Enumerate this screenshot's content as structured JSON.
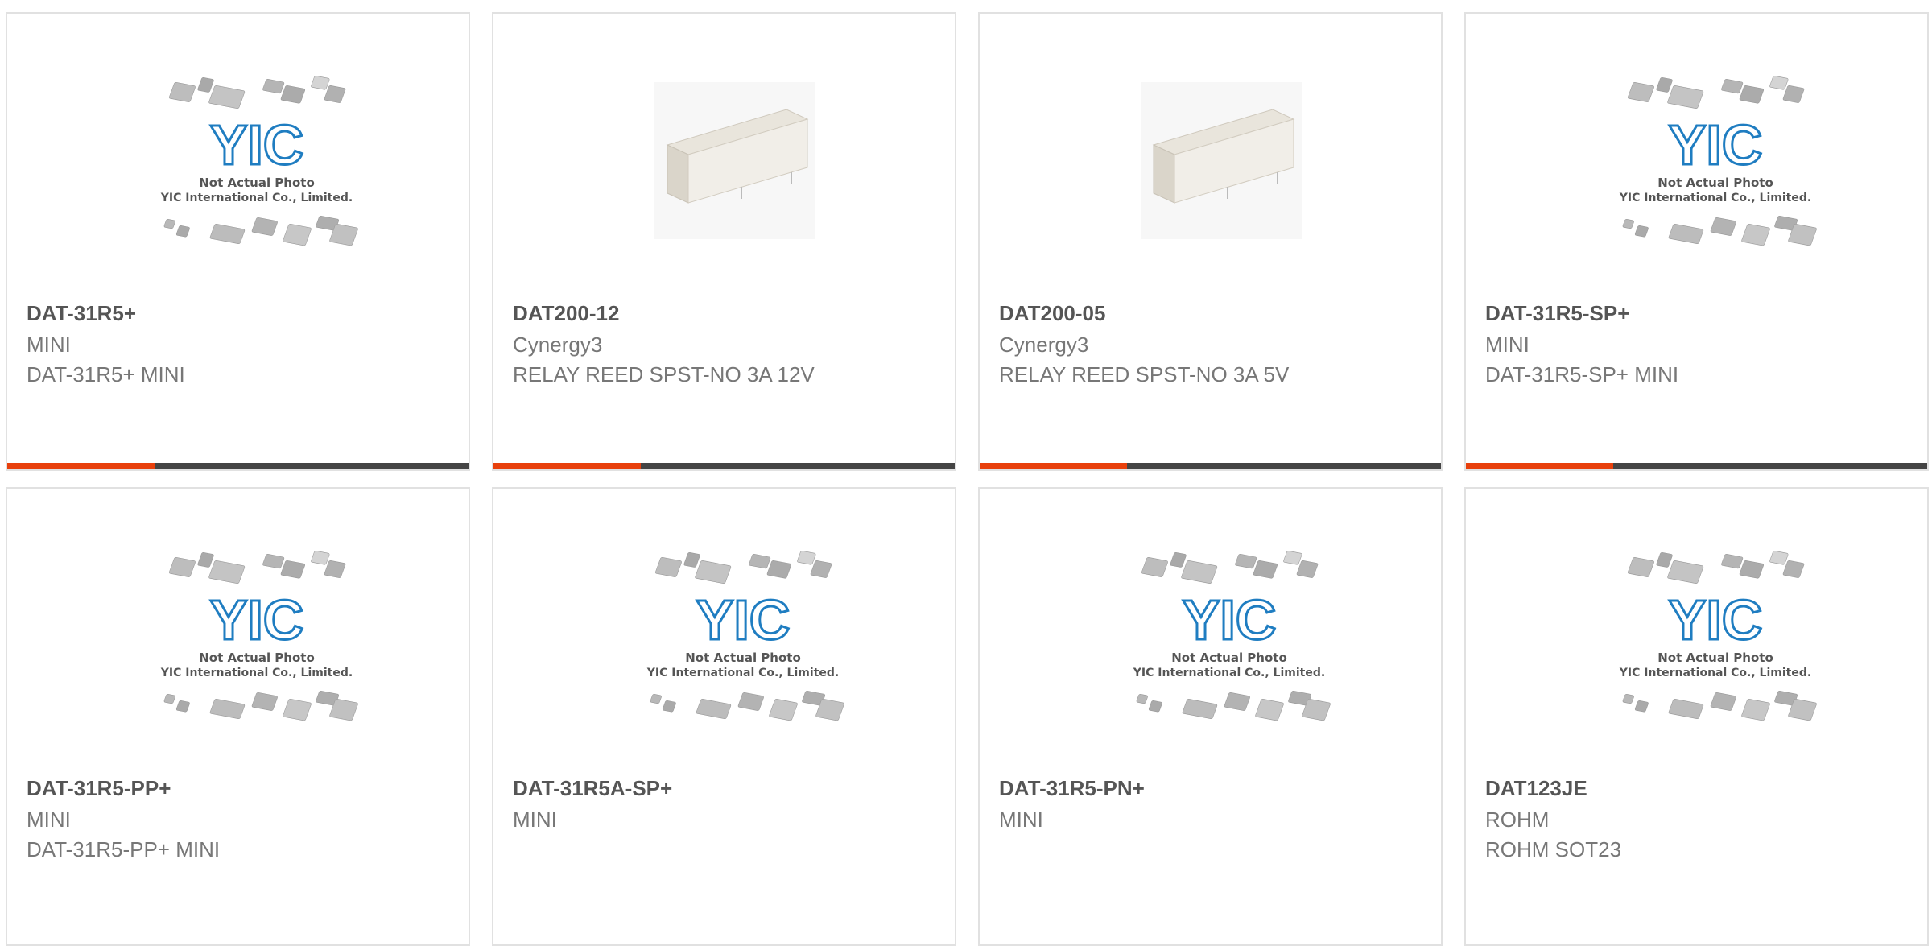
{
  "placeholder_text": {
    "line1": "Not Actual Photo",
    "line2": "YIC International Co., Limited."
  },
  "logo_text": "YIC",
  "colors": {
    "accent": "#e8400c",
    "bar": "#444444",
    "logo": "#1f7dc1"
  },
  "products": [
    {
      "part_number": "DAT-31R5+",
      "manufacturer": "MINI",
      "description": "DAT-31R5+ MINI",
      "image": "yic-placeholder"
    },
    {
      "part_number": "DAT200-12",
      "manufacturer": "Cynergy3",
      "description": "RELAY REED SPST-NO 3A 12V",
      "image": "relay-photo"
    },
    {
      "part_number": "DAT200-05",
      "manufacturer": "Cynergy3",
      "description": "RELAY REED SPST-NO 3A 5V",
      "image": "relay-photo"
    },
    {
      "part_number": "DAT-31R5-SP+",
      "manufacturer": "MINI",
      "description": "DAT-31R5-SP+ MINI",
      "image": "yic-placeholder"
    },
    {
      "part_number": "DAT-31R5-PP+",
      "manufacturer": "MINI",
      "description": "DAT-31R5-PP+ MINI",
      "image": "yic-placeholder"
    },
    {
      "part_number": "DAT-31R5A-SP+",
      "manufacturer": "MINI",
      "description": "",
      "image": "yic-placeholder"
    },
    {
      "part_number": "DAT-31R5-PN+",
      "manufacturer": "MINI",
      "description": "",
      "image": "yic-placeholder"
    },
    {
      "part_number": "DAT123JE",
      "manufacturer": "ROHM",
      "description": "ROHM SOT23",
      "image": "yic-placeholder"
    }
  ]
}
